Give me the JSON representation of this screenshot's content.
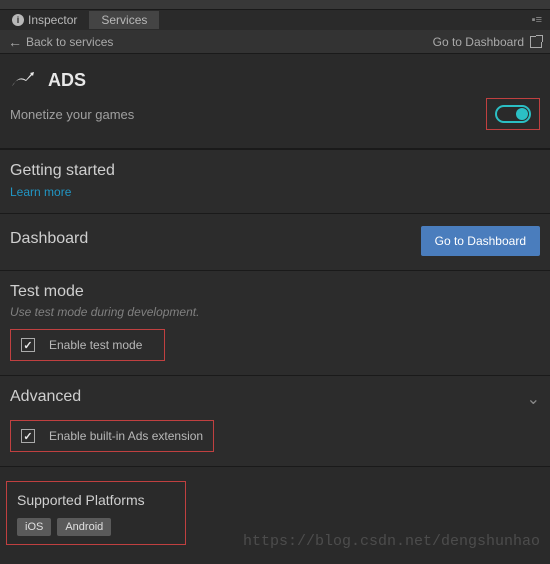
{
  "tabs": {
    "inspector": "Inspector",
    "services": "Services"
  },
  "subheader": {
    "back": "Back to services",
    "goto": "Go to Dashboard"
  },
  "title": "ADS",
  "subtitle": "Monetize your games",
  "toggle": {
    "on": true
  },
  "getting_started": {
    "title": "Getting started",
    "learn": "Learn more"
  },
  "dashboard": {
    "title": "Dashboard",
    "button": "Go to Dashboard"
  },
  "test_mode": {
    "title": "Test mode",
    "sub": "Use test mode during development.",
    "checkbox": "Enable test mode",
    "checked": true
  },
  "advanced": {
    "title": "Advanced",
    "checkbox": "Enable built-in Ads extension",
    "checked": true
  },
  "platforms": {
    "title": "Supported Platforms",
    "tags": [
      "iOS",
      "Android"
    ]
  },
  "watermark": "https://blog.csdn.net/dengshunhao"
}
